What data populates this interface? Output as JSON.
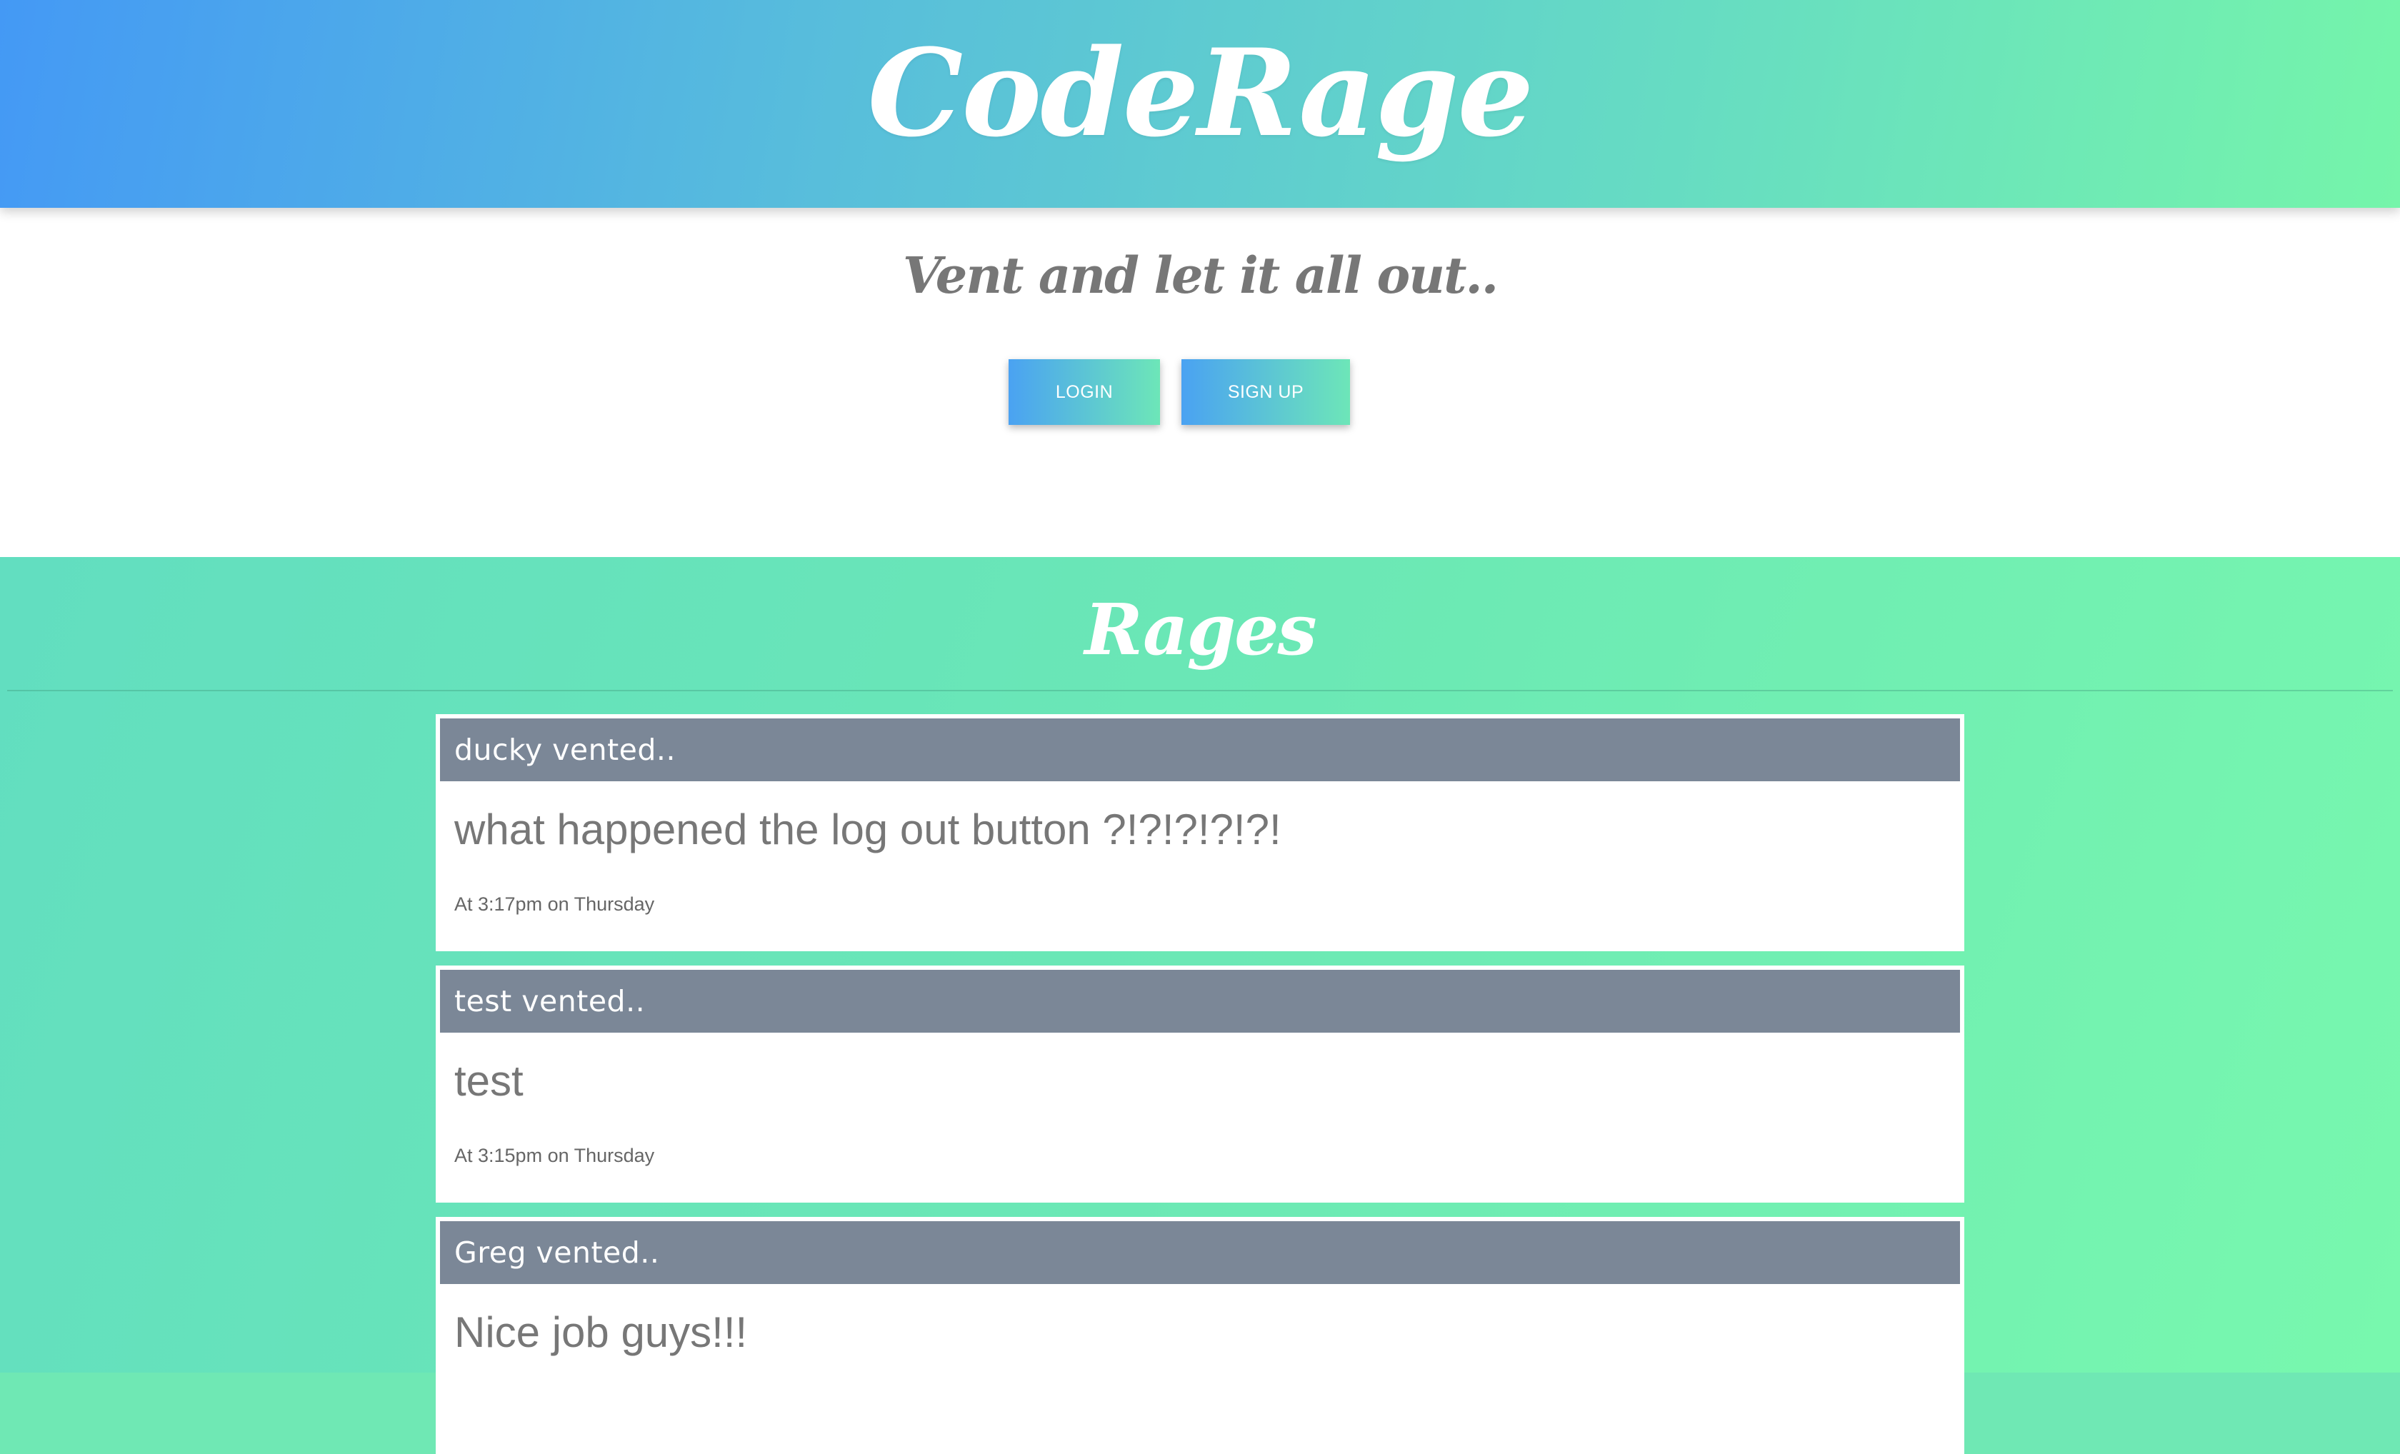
{
  "header": {
    "logo": "CodeRage"
  },
  "hero": {
    "tagline": "Vent and let it all out..",
    "login_label": "LOGIN",
    "signup_label": "SIGN UP"
  },
  "feed": {
    "title": "Rages",
    "posts": [
      {
        "author": "ducky vented..",
        "message": "what happened the log out button ?!?!?!?!?!",
        "time": "At 3:17pm on Thursday"
      },
      {
        "author": "test vented..",
        "message": "test",
        "time": "At 3:15pm on Thursday"
      },
      {
        "author": "Greg vented..",
        "message": "Nice job guys!!!",
        "time": ""
      }
    ]
  },
  "colors": {
    "header_gradient_start": "#4499f5",
    "header_gradient_end": "#75f5aa",
    "feed_background": "#6be8b5",
    "card_header": "#7b8797",
    "text_gray": "#777777"
  }
}
